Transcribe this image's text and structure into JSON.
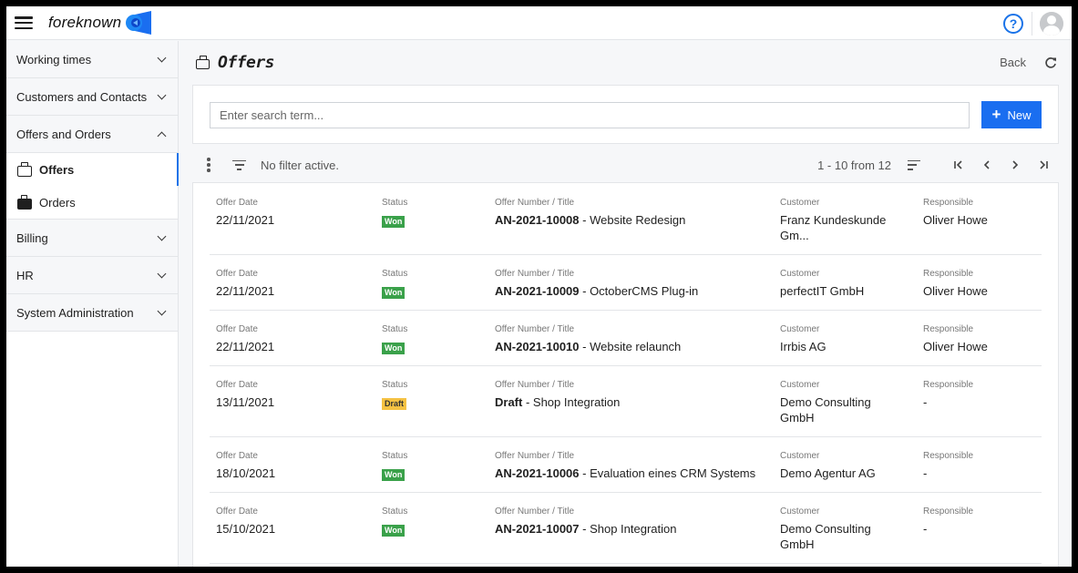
{
  "header": {
    "brand": "foreknown",
    "help_icon": "question-circle-icon",
    "avatar_icon": "user-avatar-icon"
  },
  "sidebar": {
    "sections": [
      {
        "label": "Working times",
        "expanded": false
      },
      {
        "label": "Customers and Contacts",
        "expanded": false
      },
      {
        "label": "Offers and Orders",
        "expanded": true,
        "items": [
          {
            "label": "Offers",
            "active": true,
            "icon": "briefcase-outline-icon"
          },
          {
            "label": "Orders",
            "active": false,
            "icon": "briefcase-filled-icon"
          }
        ]
      },
      {
        "label": "Billing",
        "expanded": false
      },
      {
        "label": "HR",
        "expanded": false
      },
      {
        "label": "System Administration",
        "expanded": false
      }
    ]
  },
  "page": {
    "title": "Offers",
    "back_label": "Back"
  },
  "search": {
    "placeholder": "Enter search term...",
    "value": "",
    "new_label": "New"
  },
  "toolbar": {
    "filter_text": "No filter active.",
    "range": "1 - 10 from 12"
  },
  "labels": {
    "date": "Offer Date",
    "status": "Status",
    "title": "Offer Number / Title",
    "customer": "Customer",
    "responsible": "Responsible"
  },
  "colors": {
    "accent": "#1a6ef0",
    "won": "#3aa14a",
    "draft": "#f5c243"
  },
  "offers": [
    {
      "date": "22/11/2021",
      "status": "Won",
      "number": "AN-2021-10008",
      "title": " - Website Redesign",
      "customer": "Franz Kundeskunde Gm...",
      "responsible": "Oliver Howe"
    },
    {
      "date": "22/11/2021",
      "status": "Won",
      "number": "AN-2021-10009",
      "title": " - OctoberCMS Plug-in",
      "customer": "perfectIT GmbH",
      "responsible": "Oliver Howe"
    },
    {
      "date": "22/11/2021",
      "status": "Won",
      "number": "AN-2021-10010",
      "title": " - Website relaunch",
      "customer": "Irrbis AG",
      "responsible": "Oliver Howe"
    },
    {
      "date": "13/11/2021",
      "status": "Draft",
      "number": "Draft",
      "title": " - Shop Integration",
      "customer": "Demo Consulting GmbH",
      "responsible": "-"
    },
    {
      "date": "18/10/2021",
      "status": "Won",
      "number": "AN-2021-10006",
      "title": " - Evaluation eines CRM Systems",
      "customer": "Demo Agentur AG",
      "responsible": "-"
    },
    {
      "date": "15/10/2021",
      "status": "Won",
      "number": "AN-2021-10007",
      "title": " - Shop Integration",
      "customer": "Demo Consulting GmbH",
      "responsible": "-"
    }
  ]
}
